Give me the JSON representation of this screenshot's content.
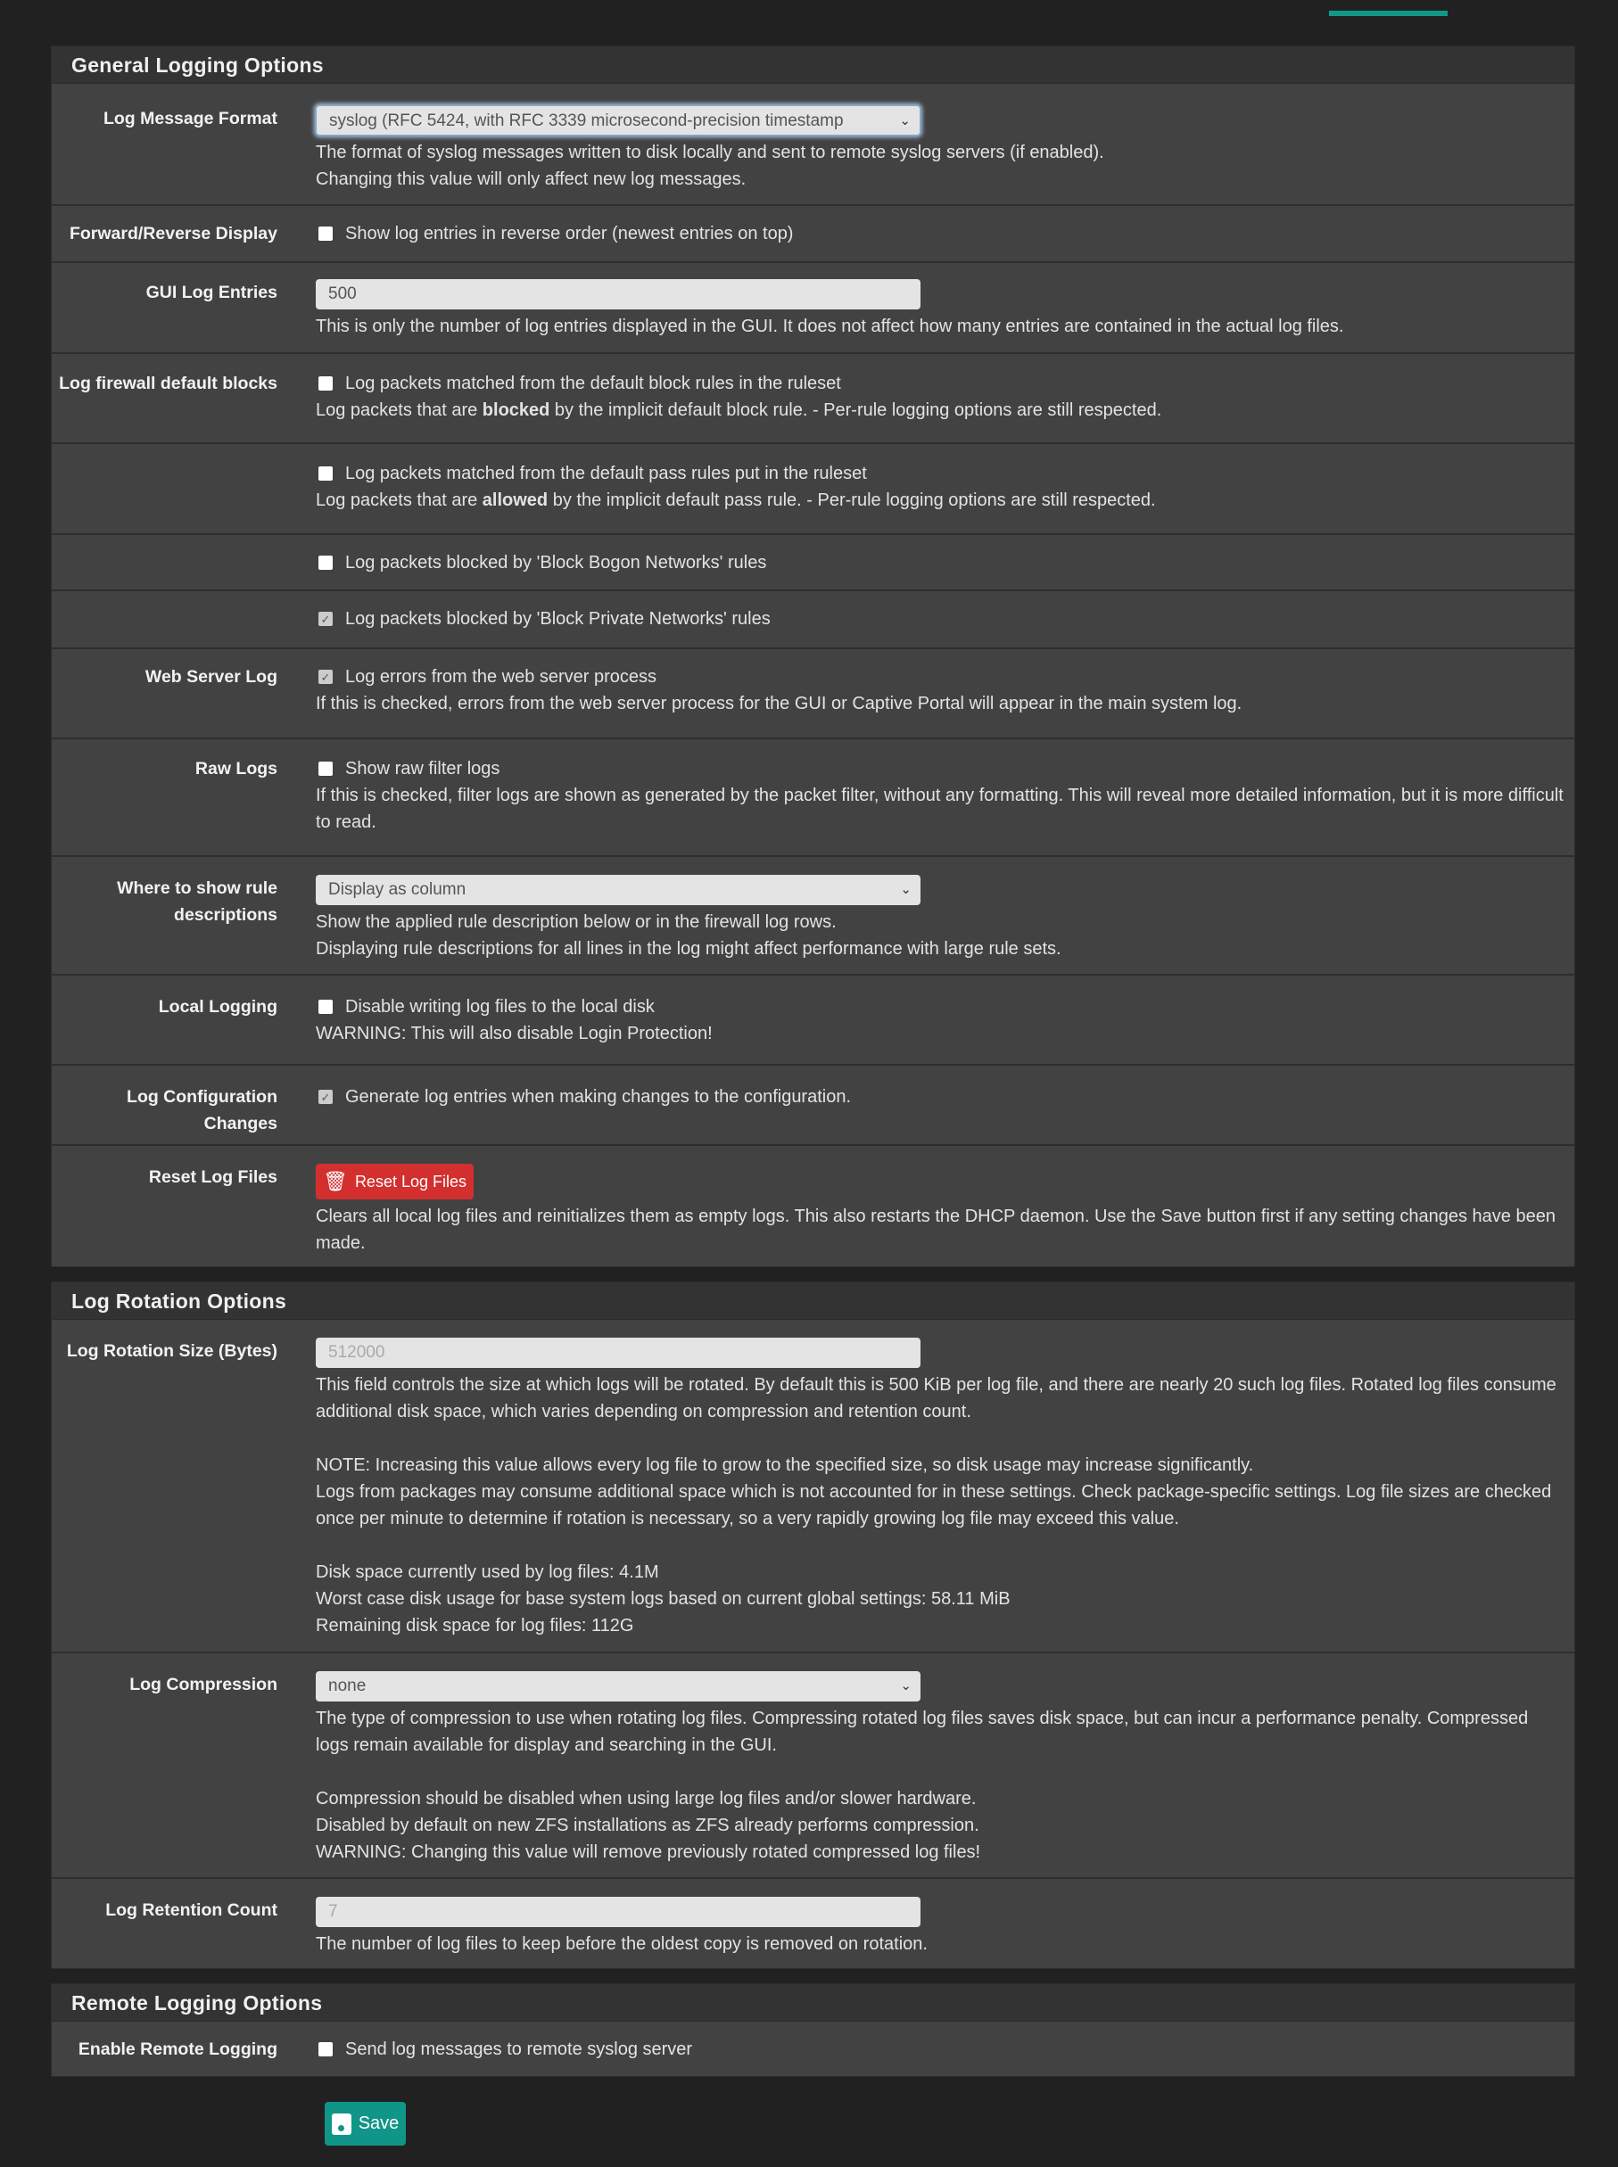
{
  "general": {
    "title": "General Logging Options",
    "log_message_format": {
      "label": "Log Message Format",
      "value": "syslog (RFC 5424, with RFC 3339 microsecond-precision timestamp",
      "help1": "The format of syslog messages written to disk locally and sent to remote syslog servers (if enabled).",
      "help2": "Changing this value will only affect new log messages."
    },
    "reverse": {
      "label": "Forward/Reverse Display",
      "text": "Show log entries in reverse order (newest entries on top)",
      "checked": false
    },
    "gui_entries": {
      "label": "GUI Log Entries",
      "value": "500",
      "help": "This is only the number of log entries displayed in the GUI. It does not affect how many entries are contained in the actual log files."
    },
    "fw_blocks": {
      "label": "Log firewall default blocks",
      "text": "Log packets matched from the default block rules in the ruleset",
      "help_a": "Log packets that are ",
      "help_b": "blocked",
      "help_c": " by the implicit default block rule. - Per-rule logging options are still respected.",
      "checked": false
    },
    "fw_pass": {
      "text": "Log packets matched from the default pass rules put in the ruleset",
      "help_a": "Log packets that are ",
      "help_b": "allowed",
      "help_c": " by the implicit default pass rule. - Per-rule logging options are still respected.",
      "checked": false
    },
    "bogon": {
      "text": "Log packets blocked by 'Block Bogon Networks' rules",
      "checked": false
    },
    "private": {
      "text": "Log packets blocked by 'Block Private Networks' rules",
      "checked": true
    },
    "webserver": {
      "label": "Web Server Log",
      "text": "Log errors from the web server process",
      "checked": true,
      "help": "If this is checked, errors from the web server process for the GUI or Captive Portal will appear in the main system log."
    },
    "raw": {
      "label": "Raw Logs",
      "text": "Show raw filter logs",
      "checked": false,
      "help": "If this is checked, filter logs are shown as generated by the packet filter, without any formatting. This will reveal more detailed information, but it is more difficult to read."
    },
    "rule_desc": {
      "label": "Where to show rule descriptions",
      "value": "Display as column",
      "help1": "Show the applied rule description below or in the firewall log rows.",
      "help2": "Displaying rule descriptions for all lines in the log might affect performance with large rule sets."
    },
    "local": {
      "label": "Local Logging",
      "text": "Disable writing log files to the local disk",
      "checked": false,
      "help": "WARNING: This will also disable Login Protection!"
    },
    "config": {
      "label": "Log Configuration Changes",
      "text": "Generate log entries when making changes to the configuration.",
      "checked": true
    },
    "reset": {
      "label": "Reset Log Files",
      "button": "Reset Log Files",
      "help": "Clears all local log files and reinitializes them as empty logs. This also restarts the DHCP daemon. Use the Save button first if any setting changes have been made."
    }
  },
  "rotation": {
    "title": "Log Rotation Options",
    "size": {
      "label": "Log Rotation Size (Bytes)",
      "placeholder": "512000",
      "l1": "This field controls the size at which logs will be rotated. By default this is 500 KiB per log file, and there are nearly 20 such log files. Rotated log files consume additional disk space, which varies depending on compression and retention count.",
      "l2": "NOTE: Increasing this value allows every log file to grow to the specified size, so disk usage may increase significantly.",
      "l3": "Logs from packages may consume additional space which is not accounted for in these settings. Check package-specific settings. Log file sizes are checked once per minute to determine if rotation is necessary, so a very rapidly growing log file may exceed this value.",
      "l4": "Disk space currently used by log files: 4.1M",
      "l5": "Worst case disk usage for base system logs based on current global settings: 58.11 MiB",
      "l6": "Remaining disk space for log files: 112G"
    },
    "compression": {
      "label": "Log Compression",
      "value": "none",
      "l1": "The type of compression to use when rotating log files. Compressing rotated log files saves disk space, but can incur a performance penalty. Compressed logs remain available for display and searching in the GUI.",
      "l2": "Compression should be disabled when using large log files and/or slower hardware.",
      "l3": "Disabled by default on new ZFS installations as ZFS already performs compression.",
      "l4": "WARNING: Changing this value will remove previously rotated compressed log files!"
    },
    "retention": {
      "label": "Log Retention Count",
      "placeholder": "7",
      "help": "The number of log files to keep before the oldest copy is removed on rotation."
    }
  },
  "remote": {
    "title": "Remote Logging Options",
    "enable": {
      "label": "Enable Remote Logging",
      "text": "Send log messages to remote syslog server",
      "checked": false
    }
  },
  "save_label": "Save",
  "colors": {
    "accent": "#0f9688",
    "danger": "#d32f2f"
  }
}
